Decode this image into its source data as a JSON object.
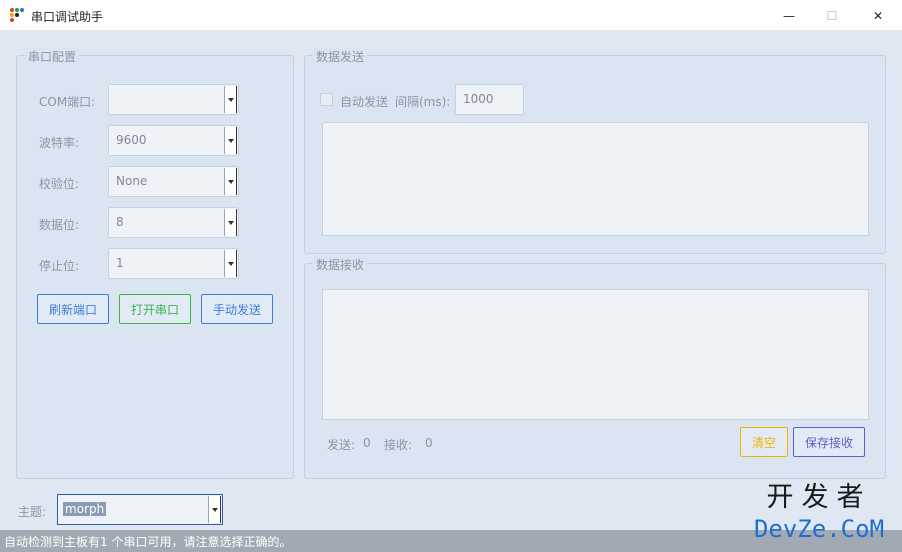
{
  "window": {
    "title": "串口调试助手",
    "minimize_glyph": "—",
    "maximize_glyph": "☐",
    "close_glyph": "✕"
  },
  "serial_config": {
    "legend": "串口配置",
    "fields": [
      {
        "label": "COM端口:",
        "value": ""
      },
      {
        "label": "波特率:",
        "value": "9600"
      },
      {
        "label": "校验位:",
        "value": "None"
      },
      {
        "label": "数据位:",
        "value": "8"
      },
      {
        "label": "停止位:",
        "value": "1"
      }
    ],
    "buttons": {
      "refresh": "刷新端口",
      "open": "打开串口",
      "manual_send": "手动发送"
    }
  },
  "data_send": {
    "legend": "数据发送",
    "auto_send_label": "自动发送",
    "interval_label": "间隔(ms):",
    "interval_value": "1000",
    "content": ""
  },
  "data_receive": {
    "legend": "数据接收",
    "content": "",
    "sent_label": "发送:",
    "sent_count": "0",
    "recv_label": "接收:",
    "recv_count": "0",
    "buttons": {
      "clear": "清空",
      "save": "保存接收"
    }
  },
  "theme": {
    "label": "主题:",
    "value": "morph"
  },
  "status": {
    "message": "自动检测到主板有1 个串口可用，请注意选择正确的。"
  },
  "watermark": {
    "top": "开发者",
    "bottom": "DevZe.CoM"
  },
  "colors": {
    "background": "#dfe7f3",
    "primary_blue": "#3b7ddd",
    "success_green": "#3bb54a",
    "warning_yellow": "#f0b400",
    "secondary_indigo": "#5a5fc8"
  }
}
